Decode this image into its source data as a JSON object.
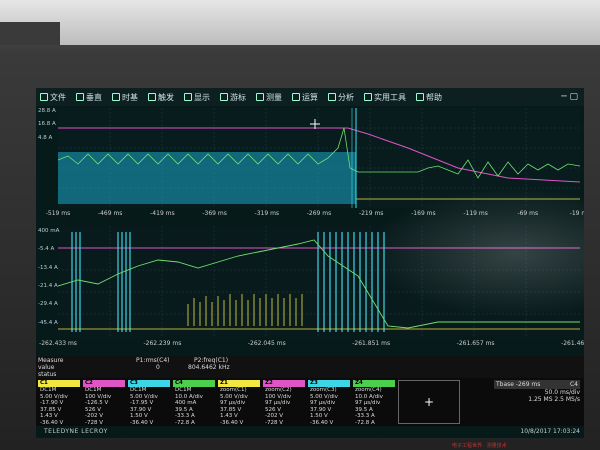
{
  "menu": {
    "items": [
      "文件",
      "垂直",
      "时基",
      "触发",
      "显示",
      "游标",
      "测量",
      "运算",
      "分析",
      "实用工具",
      "帮助"
    ],
    "window_controls": "─ ▢"
  },
  "top_axis": {
    "x_ticks": [
      "-519 ms",
      "-469 ms",
      "-419 ms",
      "-369 ms",
      "-319 ms",
      "-269 ms",
      "-219 ms",
      "-169 ms",
      "-119 ms",
      "-69 ms",
      "-19 ms"
    ],
    "y_ticks": [
      "28.8 A",
      "16.8 A",
      "4.8 A"
    ]
  },
  "bottom_axis": {
    "x_ticks": [
      "-262.433 ms",
      "-262.239 ms",
      "-262.045 ms",
      "-261.851 ms",
      "-261.657 ms",
      "-261.463 ms"
    ],
    "y_ticks": [
      "400 mA",
      "-5.4 A",
      "-13.4 A",
      "-21.4 A",
      "-29.4 A",
      "-45.4 A"
    ]
  },
  "measure": {
    "headers": [
      "Measure",
      "value",
      "status"
    ],
    "p1": {
      "label": "P1:rms(C4)",
      "value": "0"
    },
    "p2": {
      "label": "P2:freq(C1)",
      "value": "804.6462 kHz"
    }
  },
  "channels": [
    {
      "name": "C1",
      "color": "#f2e642",
      "lines": [
        "DC1M",
        "5.00 V/div",
        "-17.90 V",
        "37.85 V",
        "1.43 V",
        "-36.40 V"
      ]
    },
    {
      "name": "C2",
      "color": "#e055c5",
      "lines": [
        "DC1M",
        "100 V/div",
        "-126.5 V",
        "526 V",
        "-202 V",
        "-728 V"
      ]
    },
    {
      "name": "C3",
      "color": "#3cd6e6",
      "lines": [
        "DC1M",
        "5.00 V/div",
        "-17.95 V",
        "37.90 V",
        "1.50 V",
        "-36.40 V"
      ]
    },
    {
      "name": "C4",
      "color": "#4ccf4c",
      "lines": [
        "DC1M",
        "10.0 A/div",
        "400 mA",
        "39.5 A",
        "-33.3 A",
        "-72.8 A"
      ]
    },
    {
      "name": "Z1",
      "color": "#f2e642",
      "lines": [
        "zoom(C1)",
        "5.00 V/div",
        "97 μs/div",
        "37.85 V",
        "1.43 V",
        "-36.40 V"
      ]
    },
    {
      "name": "Z2",
      "color": "#e055c5",
      "lines": [
        "zoom(C2)",
        "100 V/div",
        "97 μs/div",
        "526 V",
        "-202 V",
        "-728 V"
      ]
    },
    {
      "name": "Z3",
      "color": "#3cd6e6",
      "lines": [
        "zoom(C3)",
        "5.00 V/div",
        "97 μs/div",
        "37.90 V",
        "1.50 V",
        "-36.40 V"
      ]
    },
    {
      "name": "Z4",
      "color": "#4ccf4c",
      "lines": [
        "zoom(C4)",
        "10.0 A/div",
        "97 μs/div",
        "39.5 A",
        "-33.3 A",
        "-72.8 A"
      ]
    }
  ],
  "add_button": "+",
  "timebase": {
    "label": "Tbase",
    "value": "-269 ms",
    "rate": "50.0 ms/div",
    "sample": "1.25 MS  2.5 MS/s",
    "trigger": "C4"
  },
  "brand": "TELEDYNE LECROY",
  "datetime": "10/8/2017 17:03:24",
  "watermark": "电子工程世界 · 测量技术"
}
